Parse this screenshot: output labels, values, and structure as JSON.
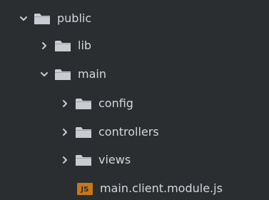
{
  "tree": {
    "items": [
      {
        "label": "public",
        "icon": "folder-icon",
        "chevron": "chevron-down-icon"
      },
      {
        "label": "lib",
        "icon": "folder-icon",
        "chevron": "chevron-right-icon"
      },
      {
        "label": "main",
        "icon": "folder-icon",
        "chevron": "chevron-down-icon"
      },
      {
        "label": "config",
        "icon": "folder-icon",
        "chevron": "chevron-right-icon"
      },
      {
        "label": "controllers",
        "icon": "folder-icon",
        "chevron": "chevron-right-icon"
      },
      {
        "label": "views",
        "icon": "folder-icon",
        "chevron": "chevron-right-icon"
      },
      {
        "label": "main.client.module.js",
        "icon": "js-file-icon",
        "badge": "JS"
      }
    ]
  },
  "colors": {
    "background": "#2b2e31",
    "text": "#d4d7db",
    "folder": "#c8ccd1",
    "chevron": "#c8ccd1",
    "js_badge": "#c9771a"
  }
}
